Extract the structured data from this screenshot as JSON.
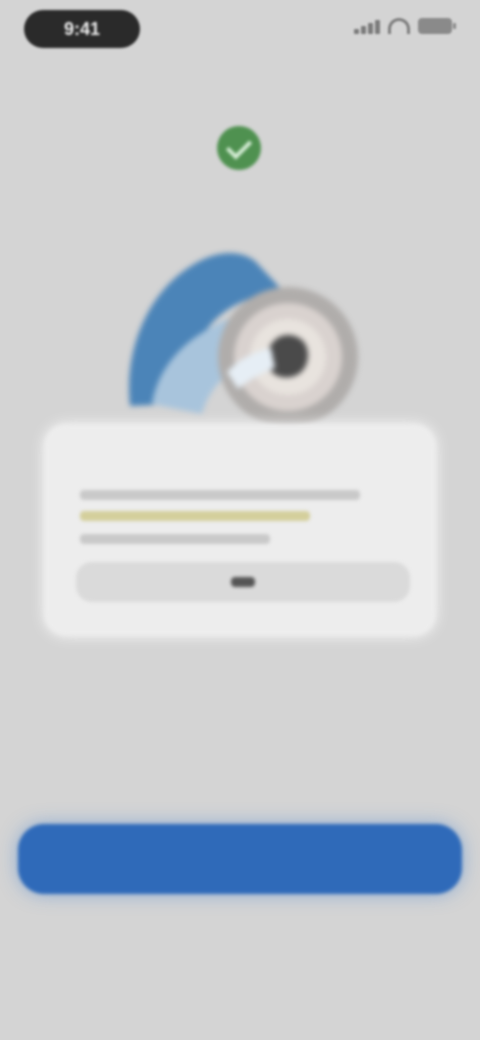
{
  "status_bar": {
    "time": "9:41"
  },
  "header": {
    "back_label": "",
    "headline": ""
  },
  "notice_card": {
    "title": "",
    "action_label": ""
  },
  "footer": {
    "note": "",
    "primary_button_label": "",
    "secondary_link_label": ""
  },
  "colors": {
    "background": "#d4d4d4",
    "accent_blue": "#2f6ab9",
    "success_green": "#4f9150",
    "card_background": "#ededed"
  },
  "icons": {
    "status_signal": "cellular-signal-icon",
    "status_wifi": "wifi-icon",
    "status_battery": "battery-icon",
    "success": "check-icon"
  }
}
